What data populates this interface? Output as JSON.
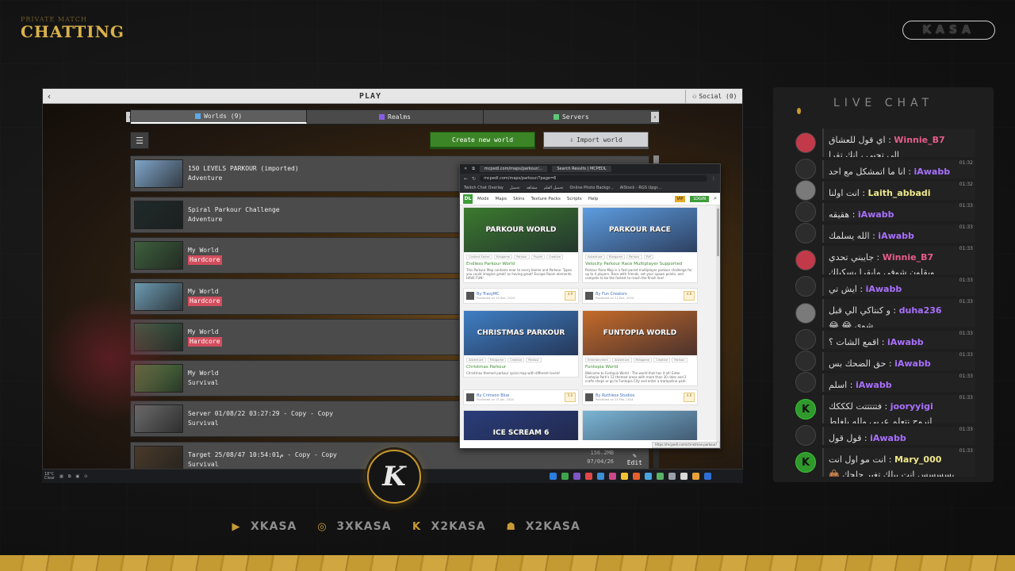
{
  "overlay": {
    "brand_small": "PRIVATE MATCH",
    "brand_scene": "CHATTING",
    "kasa_label": "KASA",
    "chat_title": "LIVE CHAT",
    "logo_letter": "K",
    "socials": [
      {
        "icon": "youtube-icon",
        "label": "XKASA"
      },
      {
        "icon": "instagram-icon",
        "label": "3XKASA"
      },
      {
        "icon": "kick-icon",
        "label": "X2KASA"
      },
      {
        "icon": "snapchat-icon",
        "label": "X2KASA"
      }
    ]
  },
  "minecraft": {
    "back": "‹",
    "title": "PLAY",
    "social": "Social (0)",
    "tabs": [
      {
        "label": "Worlds (9)",
        "color": "#5fa9e8"
      },
      {
        "label": "Realms",
        "color": "#8a5be6"
      },
      {
        "label": "Servers",
        "color": "#5cc97a"
      }
    ],
    "create_button": "Create new world",
    "import_button": "Import world",
    "worlds": [
      {
        "name": "150 LEVELS PARKOUR (imported)",
        "mode": "Adventure",
        "hard": false,
        "thumb": "#7fa5c9",
        "size": "",
        "date": "",
        "edit": ""
      },
      {
        "name": "Spiral Parkour Challenge",
        "mode": "Adventure",
        "hard": false,
        "thumb": "#1f2a2a",
        "size": "",
        "date": "",
        "edit": ""
      },
      {
        "name": "My World",
        "mode": "Hardcore",
        "hard": true,
        "thumb": "#3d5f3d",
        "size": "",
        "date": "",
        "edit": ""
      },
      {
        "name": "My World",
        "mode": "Hardcore",
        "hard": true,
        "thumb": "#6c9ab1",
        "size": "",
        "date": "",
        "edit": ""
      },
      {
        "name": "My World",
        "mode": "Hardcore",
        "hard": true,
        "thumb": "#42644a",
        "size": "",
        "date": "",
        "edit": ""
      },
      {
        "name": "My World",
        "mode": "Survival",
        "hard": false,
        "thumb": "#5a8a4a",
        "size": "",
        "date": "",
        "edit": ""
      },
      {
        "name": "Server 01/08/22 03:27:29 - Copy - Copy",
        "mode": "Survival",
        "hard": false,
        "thumb": "#6b6b6b",
        "size": "",
        "date": "",
        "edit": ""
      },
      {
        "name": "Target 25/08/47 10:54:01م - Copy - Copy",
        "mode": "Survival",
        "hard": false,
        "thumb": "#4a3a2a",
        "size": "156.2MB",
        "date": "07/04/26",
        "edit": "Edit"
      }
    ]
  },
  "browser": {
    "tab1": "mcpedl.com/maps/parkour/...",
    "tab2": "Search Results | MCPEDL",
    "url": "mcpedl.com/maps/parkour/?page=6",
    "bookmarks": [
      "Twitch Chat Overlay",
      "تحميل",
      "مشاهد",
      "تحميل الفلم",
      "Online Photo Backgr...",
      "AIStock - RGS Upgr..."
    ],
    "nav": [
      "Mods",
      "Maps",
      "Skins",
      "Texture Packs",
      "Scripts",
      "Help"
    ],
    "vip": "VIP",
    "login": "LOGIN",
    "logo": "DL",
    "status": "https://mcpedl.com/christmas-parkour/",
    "cards": [
      {
        "img_text": "PARKOUR WORLD",
        "color": "#3b7a2e",
        "title": "Endless Parkour World",
        "desc": "This Parkour Map contains near to every biome and Parkour. Types you could imagine great! as having great! Escape Room elements. HAVE FUN!",
        "tags": [
          "Content Series",
          "Minigame",
          "Parkour",
          "Puzzle",
          "Creative"
        ]
      },
      {
        "img_text": "PARKOUR RACE",
        "color": "#5d9de0",
        "title": "Velocity Parkour Race Multiplayer Supported",
        "desc": "Parkour Race Map is a fast-paced multiplayer parkour challenge for up to 4 players. Race with friends, set your spawn points, and compete to be the fastest to reach the finish line!",
        "tags": [
          "Adventure",
          "Minigame",
          "Parkour",
          "PvP"
        ]
      },
      {
        "img_text": "CHRISTMAS PARKOUR",
        "color": "#3f7fc4",
        "title": "Christmas Parkour",
        "desc": "Christmas themed parkour spiral map with different levels!",
        "tags": [
          "Adventure",
          "Minigame",
          "Creative",
          "Parkour"
        ]
      },
      {
        "img_text": "FUNTOPIA WORLD",
        "color": "#c46b2a",
        "title": "Funtopia World",
        "desc": "Welcome to Funtopia World - The world that has it all! Enter Funtopia Park's 12 themed areas with more than 30 rides and 2 crafts shops or go to Funtopia City and enter a trampoline park.",
        "tags": [
          "Entertainment",
          "Adventure",
          "Minigame",
          "Creative",
          "Parkour"
        ]
      },
      {
        "img_text": "ICE SCREAM 6",
        "color": "#2a3d7a",
        "title": "",
        "desc": "",
        "tags": []
      },
      {
        "img_text": "",
        "color": "#7ab5d4",
        "title": "",
        "desc": "",
        "tags": []
      }
    ],
    "authors": [
      {
        "name": "By TrasyMC",
        "date": "Published on 19 Dec, 2024",
        "rating": "4.9"
      },
      {
        "name": "By Fun Creators",
        "date": "Published on 21 Dec, 2024",
        "rating": "4.8"
      },
      {
        "name": "By Crimson Blue",
        "date": "Published on 15 Jan, 2024",
        "rating": "5.0"
      },
      {
        "name": "By Ruthless Studios",
        "date": "Published on 13 Feb, 2024",
        "rating": "4.8"
      }
    ]
  },
  "taskbar": {
    "weather": "18°C",
    "weather_sub": "Clear"
  },
  "chat": {
    "messages": [
      {
        "user": "Winnie_B7",
        "text": "اي قول للعشاق الي تحبي ، انك تقرا",
        "time": "",
        "avatar": "red",
        "user_color": "pink",
        "tall": true
      },
      {
        "user": "iAwabb",
        "text": "انا ما اتمشكل مع احد الحمدلله",
        "time": "01:32",
        "avatar": "dark",
        "user_color": "",
        "tall": false
      },
      {
        "user": "Laith_abbadi",
        "text": "انت اولنا",
        "time": "01:32",
        "avatar": "img",
        "user_color": "yellow",
        "tall": false
      },
      {
        "user": "iAwabb",
        "text": "هقيقه",
        "time": "01:33",
        "avatar": "dark",
        "user_color": "",
        "tall": false
      },
      {
        "user": "iAwabb",
        "text": "الله يسلمك",
        "time": "01:33",
        "avatar": "dark",
        "user_color": "",
        "tall": false
      },
      {
        "user": "Winnie_B7",
        "text": "جايبني تحدي ويقلون شوفي مايقرا بسكيلك",
        "time": "01:33",
        "avatar": "red",
        "user_color": "pink",
        "tall": true
      },
      {
        "user": "iAwabb",
        "text": "ايش تي",
        "time": "01:33",
        "avatar": "dark",
        "user_color": "",
        "tall": false
      },
      {
        "user": "duha236",
        "text": "و كنتاكي الي قبل شوي 😂 😂",
        "time": "01:33",
        "avatar": "img",
        "user_color": "",
        "tall": true
      },
      {
        "user": "iAwabb",
        "text": "اقمع الشات ؟",
        "time": "01:33",
        "avatar": "dark",
        "user_color": "",
        "tall": false
      },
      {
        "user": "iAwabb",
        "text": "حق الضحك بس",
        "time": "01:33",
        "avatar": "dark",
        "user_color": "",
        "tall": false
      },
      {
        "user": "iAwabb",
        "text": "اسلم",
        "time": "01:33",
        "avatar": "dark",
        "user_color": "",
        "tall": false
      },
      {
        "user": "jooryyigi",
        "text": "فتتتتتت لكككك انروح نتعلم عربي ولله بلغلط هههههه",
        "time": "01:33",
        "avatar": "green",
        "user_color": "",
        "tall": true
      },
      {
        "user": "iAwabb",
        "text": "قول قول",
        "time": "01:33",
        "avatar": "dark",
        "user_color": "",
        "tall": false
      },
      {
        "user": "Mary_000",
        "text": "انت مو اول انت بسسسس انت يبلك تغير حلجك 👜",
        "time": "01:33",
        "avatar": "green",
        "user_color": "yellow",
        "tall": true
      }
    ]
  }
}
